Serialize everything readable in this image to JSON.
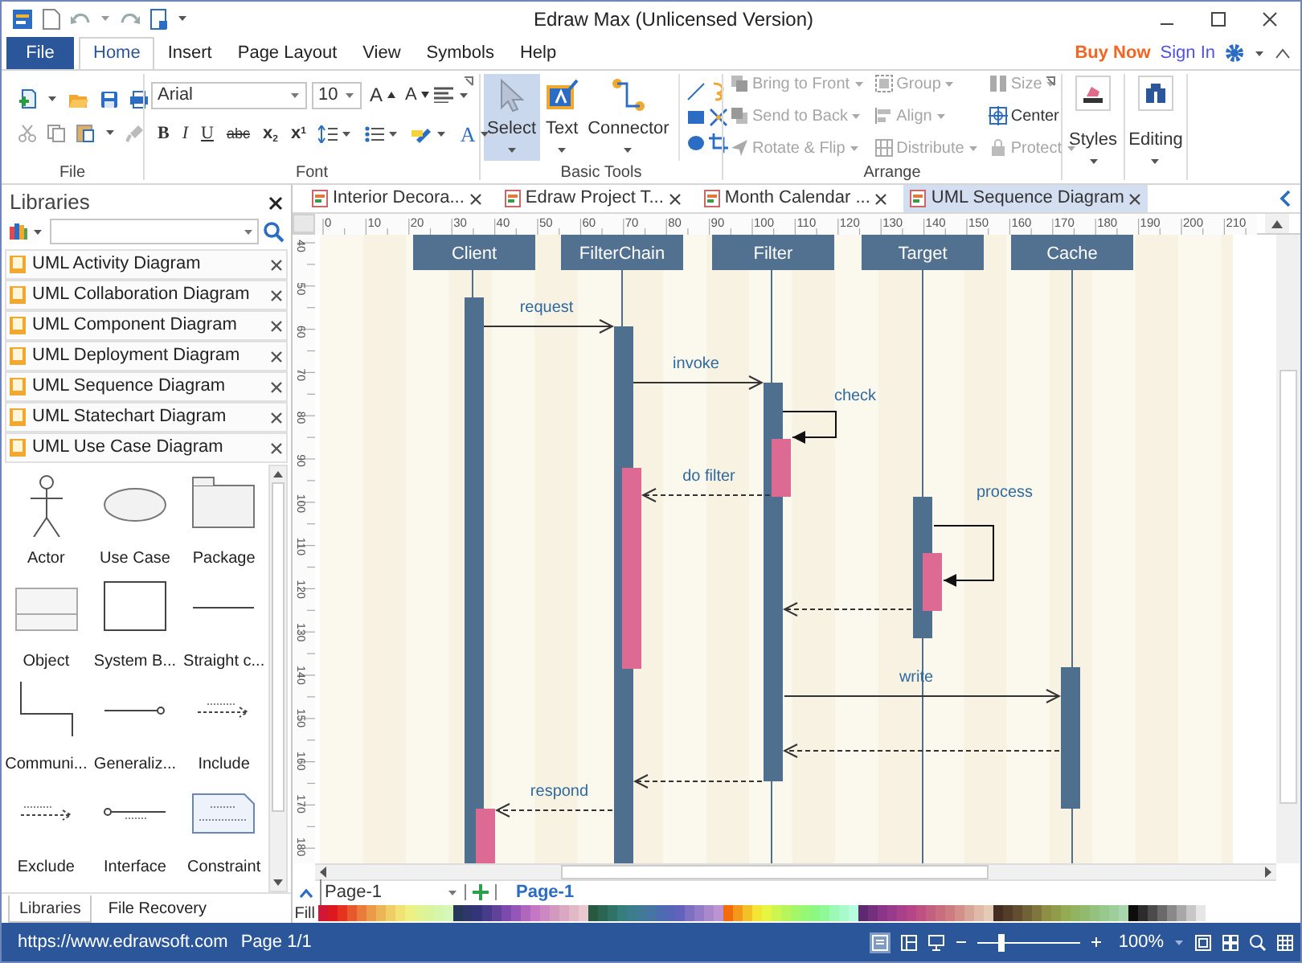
{
  "window": {
    "title": "Edraw Max (Unlicensed Version)"
  },
  "ribbon_tabs": [
    {
      "label": "File",
      "kind": "file",
      "selected": false
    },
    {
      "label": "Home",
      "kind": "tab",
      "selected": true
    },
    {
      "label": "Insert",
      "kind": "tab",
      "selected": false
    },
    {
      "label": "Page Layout",
      "kind": "tab",
      "selected": false
    },
    {
      "label": "View",
      "kind": "tab",
      "selected": false
    },
    {
      "label": "Symbols",
      "kind": "tab",
      "selected": false
    },
    {
      "label": "Help",
      "kind": "tab",
      "selected": false
    }
  ],
  "account": {
    "buy_now": "Buy Now",
    "sign_in": "Sign In"
  },
  "file_group": {
    "label": "File"
  },
  "font_group": {
    "label": "Font",
    "font": "Arial",
    "size": "10",
    "grow": "A",
    "shrink": "A",
    "format_buttons": [
      "B",
      "I",
      "U",
      "abc"
    ],
    "subscript": {
      "base": "x",
      "mark": "2"
    },
    "superscript": {
      "base": "x",
      "mark": "1"
    },
    "font_color": "A"
  },
  "basic_tools": {
    "label": "Basic Tools",
    "tools": [
      {
        "label": "Select",
        "selected": true
      },
      {
        "label": "Text",
        "selected": false
      },
      {
        "label": "Connector",
        "selected": false
      }
    ]
  },
  "arrange": {
    "label": "Arrange",
    "commands": [
      {
        "label": "Bring to Front",
        "disabled": true,
        "dropdown": true
      },
      {
        "label": "Group",
        "disabled": true,
        "dropdown": true
      },
      {
        "label": "Size",
        "disabled": true,
        "dropdown": true
      },
      {
        "label": "Send to Back",
        "disabled": true,
        "dropdown": true
      },
      {
        "label": "Align",
        "disabled": true,
        "dropdown": true
      },
      {
        "label": "Center",
        "disabled": false,
        "dropdown": false
      },
      {
        "label": "Rotate & Flip",
        "disabled": true,
        "dropdown": true
      },
      {
        "label": "Distribute",
        "disabled": true,
        "dropdown": true
      },
      {
        "label": "Protect",
        "disabled": true,
        "dropdown": true
      }
    ]
  },
  "styles": {
    "label": "Styles"
  },
  "editing": {
    "label": "Editing"
  },
  "libraries": {
    "title": "Libraries",
    "items": [
      "UML Activity Diagram",
      "UML Collaboration Diagram",
      "UML Component Diagram",
      "UML Deployment Diagram",
      "UML Sequence Diagram",
      "UML Statechart Diagram",
      "UML Use Case Diagram"
    ],
    "shapes": [
      {
        "label": "Actor",
        "kind": "actor"
      },
      {
        "label": "Use Case",
        "kind": "usecase"
      },
      {
        "label": "Package",
        "kind": "package"
      },
      {
        "label": "Object",
        "kind": "object"
      },
      {
        "label": "System B...",
        "kind": "system"
      },
      {
        "label": "Straight c...",
        "kind": "straight"
      },
      {
        "label": "Communi...",
        "kind": "elbow"
      },
      {
        "label": "Generaliz...",
        "kind": "general"
      },
      {
        "label": "Include",
        "kind": "include"
      },
      {
        "label": "Exclude",
        "kind": "exclude"
      },
      {
        "label": "Interface",
        "kind": "interface"
      },
      {
        "label": "Constraint",
        "kind": "constraint"
      }
    ]
  },
  "panel_tabs": [
    {
      "label": "Libraries",
      "selected": true
    },
    {
      "label": "File Recovery",
      "selected": false
    }
  ],
  "doc_tabs": [
    {
      "label": "Interior Decora...",
      "selected": false
    },
    {
      "label": "Edraw Project T...",
      "selected": false
    },
    {
      "label": "Month Calendar ...",
      "selected": false
    },
    {
      "label": "UML Sequence Diagram",
      "selected": true
    }
  ],
  "ruler": {
    "horizontal": [
      "0",
      "10",
      "20",
      "30",
      "40",
      "50",
      "60",
      "70",
      "80",
      "90",
      "100",
      "110",
      "120",
      "130",
      "140",
      "150",
      "160",
      "170",
      "180",
      "190",
      "200",
      "210"
    ],
    "vertical": [
      "40",
      "50",
      "60",
      "70",
      "80",
      "90",
      "100",
      "110",
      "120",
      "130",
      "140",
      "150",
      "160",
      "170",
      "180"
    ]
  },
  "diagram": {
    "lifelines": [
      "Client",
      "FilterChain",
      "Filter",
      "Target",
      "Cache"
    ],
    "messages": [
      {
        "kind": "call",
        "label": "request"
      },
      {
        "kind": "call",
        "label": "invoke"
      },
      {
        "kind": "self",
        "label": "check"
      },
      {
        "kind": "return",
        "label": "do filter"
      },
      {
        "kind": "self",
        "label": "process"
      },
      {
        "kind": "return"
      },
      {
        "kind": "call",
        "label": "write"
      },
      {
        "kind": "return"
      },
      {
        "kind": "return"
      },
      {
        "kind": "return",
        "label": "respond"
      }
    ]
  },
  "page_bar": {
    "page_select": "Page-1",
    "pages": [
      {
        "label": "Page-1",
        "selected": true
      }
    ],
    "fill_label": "Fill"
  },
  "status_bar": {
    "url": "https://www.edrawsoft.com",
    "page": "Page 1/1",
    "zoom": "100%",
    "zoom_level": {
      "level": 0.23
    }
  }
}
